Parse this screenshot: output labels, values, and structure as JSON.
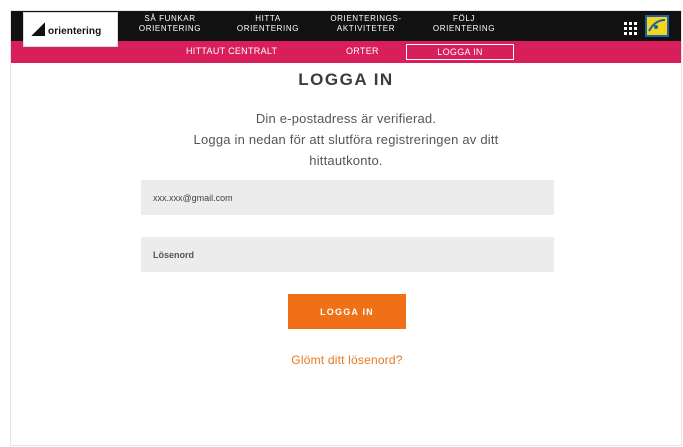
{
  "logo": {
    "text": "orientering"
  },
  "topnav": {
    "items": [
      {
        "line1": "SÅ FUNKAR",
        "line2": "ORIENTERING"
      },
      {
        "line1": "HITTA",
        "line2": "ORIENTERING"
      },
      {
        "line1": "ORIENTERINGS-",
        "line2": "AKTIVITETER"
      },
      {
        "line1": "FÖLJ",
        "line2": "ORIENTERING"
      }
    ],
    "apps_icon": "grid-icon",
    "compass_icon": "compass-icon"
  },
  "subnav": {
    "items": [
      "HITTAUT CENTRALT",
      "ORTER",
      "LOGGA IN"
    ],
    "active_index": 2
  },
  "main": {
    "title": "LOGGA IN",
    "message_line1": "Din e-postadress är verifierad.",
    "message_line2": "Logga in nedan för att slutföra registreringen av ditt",
    "message_line3": "hittautkonto.",
    "email_value": "xxx.xxx@gmail.com",
    "password_placeholder": "Lösenord",
    "login_button": "LOGGA IN",
    "forgot_link": "Glömt ditt lösenord?"
  },
  "colors": {
    "topbar": "#111111",
    "subbar": "#d81f5b",
    "button": "#f07017",
    "link": "#e87722",
    "field_bg": "#ececec"
  }
}
